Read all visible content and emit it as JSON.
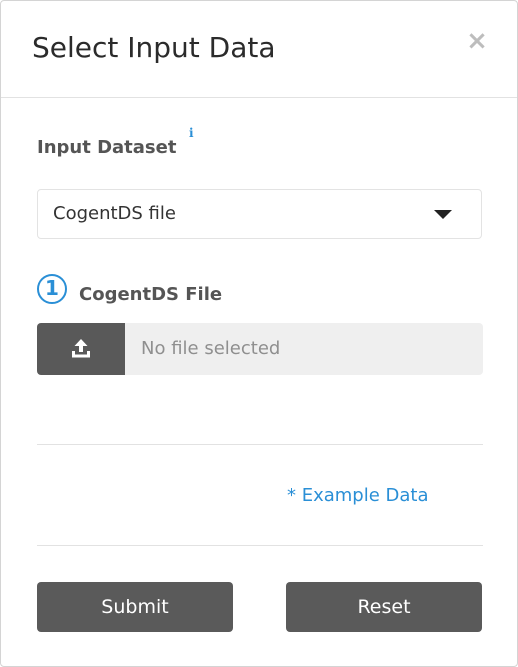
{
  "modal": {
    "title": "Select Input Data",
    "close_symbol": "×"
  },
  "input_dataset": {
    "label": "Input Dataset",
    "info_symbol": "i",
    "selected_value": "CogentDS file"
  },
  "file_upload": {
    "step_number": "1",
    "label": "CogentDS File",
    "upload_icon": "upload-icon",
    "status": "No file selected"
  },
  "example_data_link": "* Example Data",
  "buttons": {
    "submit": "Submit",
    "reset": "Reset"
  },
  "colors": {
    "accent": "#2a8fd6",
    "button_bg": "#5a5a5a",
    "file_display_bg": "#efefef"
  }
}
